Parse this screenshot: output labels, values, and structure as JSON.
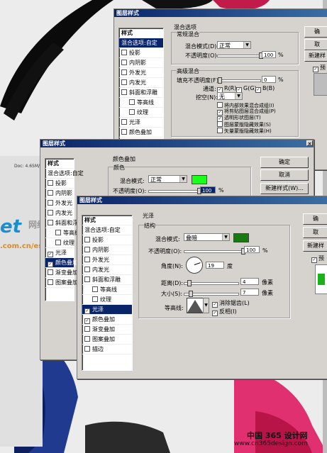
{
  "background": {
    "doc_status": "Doc: 4.65M/...",
    "wm_logo": "et",
    "wm_domain": ".com.cn/esch",
    "wm_cn": "网络学院",
    "footer_cn": "中国 365 设计网",
    "footer_url": "www.cn365design.com"
  },
  "win1": {
    "title": "图层样式",
    "styles_header": "样式",
    "styles": [
      {
        "label": "混合选项:自定",
        "checked": null,
        "selected": true
      },
      {
        "label": "投影",
        "checked": false
      },
      {
        "label": "内阴影",
        "checked": false
      },
      {
        "label": "外发光",
        "checked": false
      },
      {
        "label": "内发光",
        "checked": false
      },
      {
        "label": "斜面和浮雕",
        "checked": false
      },
      {
        "label": "等高线",
        "checked": false,
        "indent": true
      },
      {
        "label": "纹理",
        "checked": false,
        "indent": true
      },
      {
        "label": "光泽",
        "checked": false
      },
      {
        "label": "颜色叠加",
        "checked": false
      },
      {
        "label": "渐变叠加",
        "checked": false
      },
      {
        "label": "图案叠加",
        "checked": false
      }
    ],
    "section_title": "混合选项",
    "general_title": "常规混合",
    "blend_mode_label": "混合模式(D):",
    "blend_mode": "正常",
    "opacity_label": "不透明度(O):",
    "opacity": "100",
    "percent": "%",
    "advanced_title": "高级混合",
    "fill_label": "填充不透明度(F):",
    "fill": "0",
    "channels_label": "通道:",
    "channels": [
      "R(R)",
      "G(G)",
      "B(B)"
    ],
    "knockout_label": "挖空(N):",
    "knockout": "无",
    "options": [
      "将内部效果混合成组(I)",
      "将剪贴图层混合成组(P)",
      "透明形状图层(T)",
      "图层蒙版隐藏效果(S)",
      "矢量蒙版隐藏效果(H)"
    ],
    "options_checked": [
      false,
      true,
      true,
      false,
      false
    ],
    "btn_ok": "确",
    "btn_cancel": "取",
    "btn_new": "新建样",
    "preview": "预"
  },
  "win2": {
    "title": "图层样式",
    "styles_header": "样式",
    "styles": [
      {
        "label": "混合选项:自定",
        "checked": null
      },
      {
        "label": "投影",
        "checked": false
      },
      {
        "label": "内阴影",
        "checked": false
      },
      {
        "label": "外发光",
        "checked": false
      },
      {
        "label": "内发光",
        "checked": false
      },
      {
        "label": "斜面和浮雕",
        "checked": false
      },
      {
        "label": "等高线",
        "checked": false,
        "indent": true
      },
      {
        "label": "纹理",
        "checked": false,
        "indent": true
      },
      {
        "label": "光泽",
        "checked": true
      },
      {
        "label": "颜色叠加",
        "checked": true,
        "selected": true
      },
      {
        "label": "渐变叠加",
        "checked": false
      },
      {
        "label": "图案叠加",
        "checked": false
      }
    ],
    "section_title": "颜色叠加",
    "group_title": "颜色",
    "blend_mode_label": "混合模式:",
    "blend_mode": "正常",
    "swatch_color": "#19ff19",
    "opacity_label": "不透明度(O):",
    "opacity": "100",
    "percent": "%",
    "btn_ok": "确定",
    "btn_cancel": "取消",
    "btn_new": "新建样式(W)..."
  },
  "win3": {
    "title": "图层样式",
    "styles_header": "样式",
    "styles": [
      {
        "label": "混合选项:自定",
        "checked": null
      },
      {
        "label": "投影",
        "checked": false
      },
      {
        "label": "内阴影",
        "checked": false
      },
      {
        "label": "外发光",
        "checked": false
      },
      {
        "label": "内发光",
        "checked": false
      },
      {
        "label": "斜面和浮雕",
        "checked": false
      },
      {
        "label": "等高线",
        "checked": false,
        "indent": true
      },
      {
        "label": "纹理",
        "checked": false,
        "indent": true
      },
      {
        "label": "光泽",
        "checked": true,
        "selected": true
      },
      {
        "label": "颜色叠加",
        "checked": true
      },
      {
        "label": "渐变叠加",
        "checked": false
      },
      {
        "label": "图案叠加",
        "checked": false
      },
      {
        "label": "描边",
        "checked": false
      }
    ],
    "section_title": "光泽",
    "group_title": "结构",
    "blend_mode_label": "混合模式:",
    "blend_mode": "叠暗",
    "swatch_color": "#1a7a12",
    "opacity_label": "不透明度(O):",
    "opacity": "100",
    "percent": "%",
    "angle_label": "角度(N):",
    "angle": "19",
    "angle_unit": "度",
    "distance_label": "距离(D):",
    "distance": "4",
    "size_label": "大小(S):",
    "size": "7",
    "px_unit": "像素",
    "contour_label": "等高线:",
    "antialias": "消除锯齿(L)",
    "invert": "反相(I)",
    "btn_ok": "确",
    "btn_cancel": "取",
    "btn_new": "新建样",
    "preview": "预"
  }
}
